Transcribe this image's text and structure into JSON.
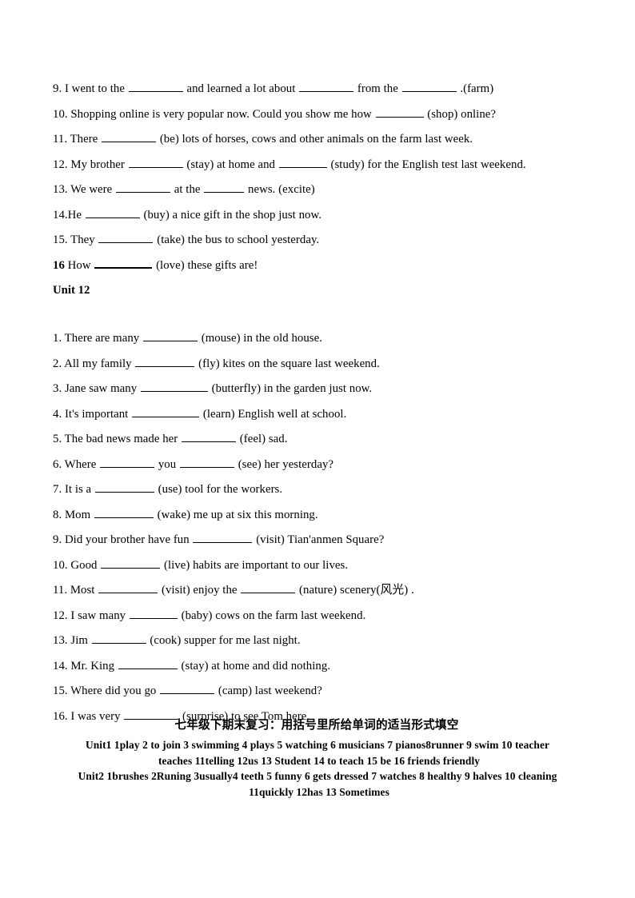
{
  "document": {
    "unit11": {
      "items": [
        {
          "id": "q9",
          "parts": [
            {
              "t": "9. I went to the"
            },
            {
              "b": "b2"
            },
            {
              "t": "and learned a lot about"
            },
            {
              "b": "b2"
            },
            {
              "t": "from the"
            },
            {
              "b": "b2"
            },
            {
              "t": ".(farm)"
            }
          ]
        },
        {
          "id": "q10",
          "parts": [
            {
              "t": "10. Shopping online is very popular now. Could you show me how"
            },
            {
              "b": "b1"
            },
            {
              "t": "(shop) online?"
            }
          ]
        },
        {
          "id": "q11",
          "parts": [
            {
              "t": "11. There"
            },
            {
              "b": "b2"
            },
            {
              "t": "(be) lots of horses, cows and other animals on the farm last week."
            }
          ]
        },
        {
          "id": "q12",
          "parts": [
            {
              "t": "12. My brother"
            },
            {
              "b": "b2"
            },
            {
              "t": "(stay) at home and"
            },
            {
              "b": "b1"
            },
            {
              "t": "(study) for the English test last weekend."
            }
          ]
        },
        {
          "id": "q13",
          "parts": [
            {
              "t": "13. We were"
            },
            {
              "b": "b2"
            },
            {
              "t": "at the"
            },
            {
              "b": "b4"
            },
            {
              "t": "news. (excite)"
            }
          ]
        },
        {
          "id": "q14",
          "parts": [
            {
              "t": "14.He"
            },
            {
              "b": "b2"
            },
            {
              "t": "(buy) a nice gift in the shop just now."
            }
          ]
        },
        {
          "id": "q15",
          "parts": [
            {
              "t": "15. They"
            },
            {
              "b": "b2"
            },
            {
              "t": "(take) the bus to school yesterday."
            }
          ]
        },
        {
          "id": "q16",
          "bold_num": "16",
          "parts": [
            {
              "t": "How"
            },
            {
              "b": "bold-blank"
            },
            {
              "t": "(love) these gifts are!"
            }
          ]
        }
      ]
    },
    "unit12_heading": "Unit 12",
    "unit12": {
      "items": [
        {
          "id": "p1",
          "parts": [
            {
              "t": "1. There are many"
            },
            {
              "b": "b2"
            },
            {
              "t": "(mouse) in the old house."
            }
          ]
        },
        {
          "id": "p2",
          "parts": [
            {
              "t": "2. All my family"
            },
            {
              "b": "b3"
            },
            {
              "t": "(fly) kites on the square last weekend."
            }
          ]
        },
        {
          "id": "p3",
          "parts": [
            {
              "t": "3. Jane saw many"
            },
            {
              "b": "b5"
            },
            {
              "t": "(butterfly) in the garden just now."
            }
          ]
        },
        {
          "id": "p4",
          "parts": [
            {
              "t": "4. It's important"
            },
            {
              "b": "b5"
            },
            {
              "t": "(learn) English well at school."
            }
          ]
        },
        {
          "id": "p5",
          "parts": [
            {
              "t": "5. The bad news made her"
            },
            {
              "b": "b2"
            },
            {
              "t": "(feel) sad."
            }
          ]
        },
        {
          "id": "p6",
          "parts": [
            {
              "t": "6. Where"
            },
            {
              "b": "b2"
            },
            {
              "t": "you"
            },
            {
              "b": "b2"
            },
            {
              "t": "(see) her yesterday?"
            }
          ]
        },
        {
          "id": "p7",
          "parts": [
            {
              "t": "7. It is a"
            },
            {
              "b": "b3"
            },
            {
              "t": "(use) tool for the workers."
            }
          ]
        },
        {
          "id": "p8",
          "parts": [
            {
              "t": "8. Mom"
            },
            {
              "b": "b3"
            },
            {
              "t": "(wake) me up at six this morning."
            }
          ]
        },
        {
          "id": "p9",
          "parts": [
            {
              "t": "9. Did your brother have fun"
            },
            {
              "b": "b3"
            },
            {
              "t": "(visit) Tian'anmen Square?"
            }
          ]
        },
        {
          "id": "p10",
          "parts": [
            {
              "t": "10. Good"
            },
            {
              "b": "b3"
            },
            {
              "t": "(live) habits are important to our lives."
            }
          ]
        },
        {
          "id": "p11",
          "parts": [
            {
              "t": "11. Most"
            },
            {
              "b": "b3"
            },
            {
              "t": "(visit) enjoy the"
            },
            {
              "b": "b2"
            },
            {
              "t": "(nature) scenery(风光) ."
            }
          ]
        },
        {
          "id": "p12",
          "parts": [
            {
              "t": "12. I saw many"
            },
            {
              "b": "b1"
            },
            {
              "t": "(baby) cows on the farm last weekend."
            }
          ]
        },
        {
          "id": "p13",
          "parts": [
            {
              "t": "13. Jim"
            },
            {
              "b": "b2"
            },
            {
              "t": "(cook) supper for me last night."
            }
          ]
        },
        {
          "id": "p14",
          "parts": [
            {
              "t": "14. Mr. King"
            },
            {
              "b": "b3"
            },
            {
              "t": "(stay) at home and did nothing."
            }
          ]
        },
        {
          "id": "p15",
          "parts": [
            {
              "t": "15. Where did you go"
            },
            {
              "b": "b2"
            },
            {
              "t": "(camp) last weekend?"
            }
          ]
        },
        {
          "id": "p16",
          "parts": [
            {
              "t": "16. I was very"
            },
            {
              "b": "b2"
            },
            {
              "t": " (surprise) to see Tom here."
            }
          ]
        }
      ]
    },
    "footer": {
      "cn_title": "七年级下期末复习：用括号里所给单词的适当形式填空",
      "answers_unit1_line1": "Unit1 1play 2 to join 3 swimming 4 plays 5 watching 6   musicians 7 pianos8runner 9 swim 10 teacher",
      "answers_unit1_line2": "teaches 11telling 12us 13 Student 14 to teach 15 be 16 friends friendly",
      "answers_unit2_line1": "Unit2 1brushes 2Runing 3usually4 teeth 5 funny 6 gets dressed 7 watches 8 healthy 9 halves 10 cleaning",
      "answers_unit2_line2": "11quickly 12has 13 Sometimes"
    }
  }
}
